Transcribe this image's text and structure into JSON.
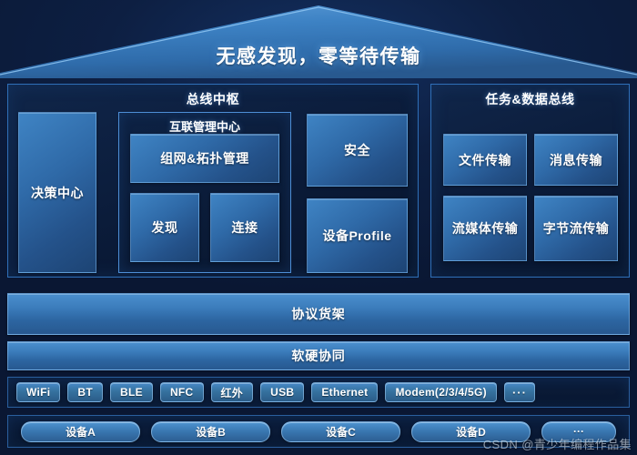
{
  "roof": {
    "title": "无感发现，零等待传输",
    "fill_light": "#3d82c4",
    "fill_dark": "#2a6099",
    "edge": "#6fb0e8"
  },
  "colors": {
    "background": "#0a1830",
    "panel_border": "#2f6fb8",
    "subpanel_border": "#4d8ed6",
    "card_light": "#3f84c4",
    "card_dark": "#1d4474",
    "text": "#ffffff"
  },
  "left_panel": {
    "title": "总线中枢",
    "decision_center": {
      "label": "决策中心"
    },
    "subpanel": {
      "title": "互联管理中心",
      "cards": [
        {
          "label": "组网&拓扑管理"
        },
        {
          "label": "发现"
        },
        {
          "label": "连接"
        }
      ]
    },
    "side_cards": [
      {
        "label": "安全"
      },
      {
        "label": "设备Profile"
      }
    ]
  },
  "right_panel": {
    "title": "任务&数据总线",
    "cards": [
      {
        "label": "文件传输"
      },
      {
        "label": "消息传输"
      },
      {
        "label": "流媒体传输"
      },
      {
        "label": "字节流传输"
      }
    ]
  },
  "bars": [
    {
      "label": "协议货架"
    },
    {
      "label": "软硬协同"
    }
  ],
  "protocols": [
    {
      "label": "WiFi"
    },
    {
      "label": "BT"
    },
    {
      "label": "BLE"
    },
    {
      "label": "NFC"
    },
    {
      "label": "红外"
    },
    {
      "label": "USB"
    },
    {
      "label": "Ethernet"
    },
    {
      "label": "Modem(2/3/4/5G)"
    },
    {
      "label": "···"
    }
  ],
  "devices": [
    {
      "label": "设备A"
    },
    {
      "label": "设备B"
    },
    {
      "label": "设备C"
    },
    {
      "label": "设备D"
    },
    {
      "label": "···"
    }
  ],
  "watermark": {
    "text": "CSDN @青少年编程作品集"
  }
}
